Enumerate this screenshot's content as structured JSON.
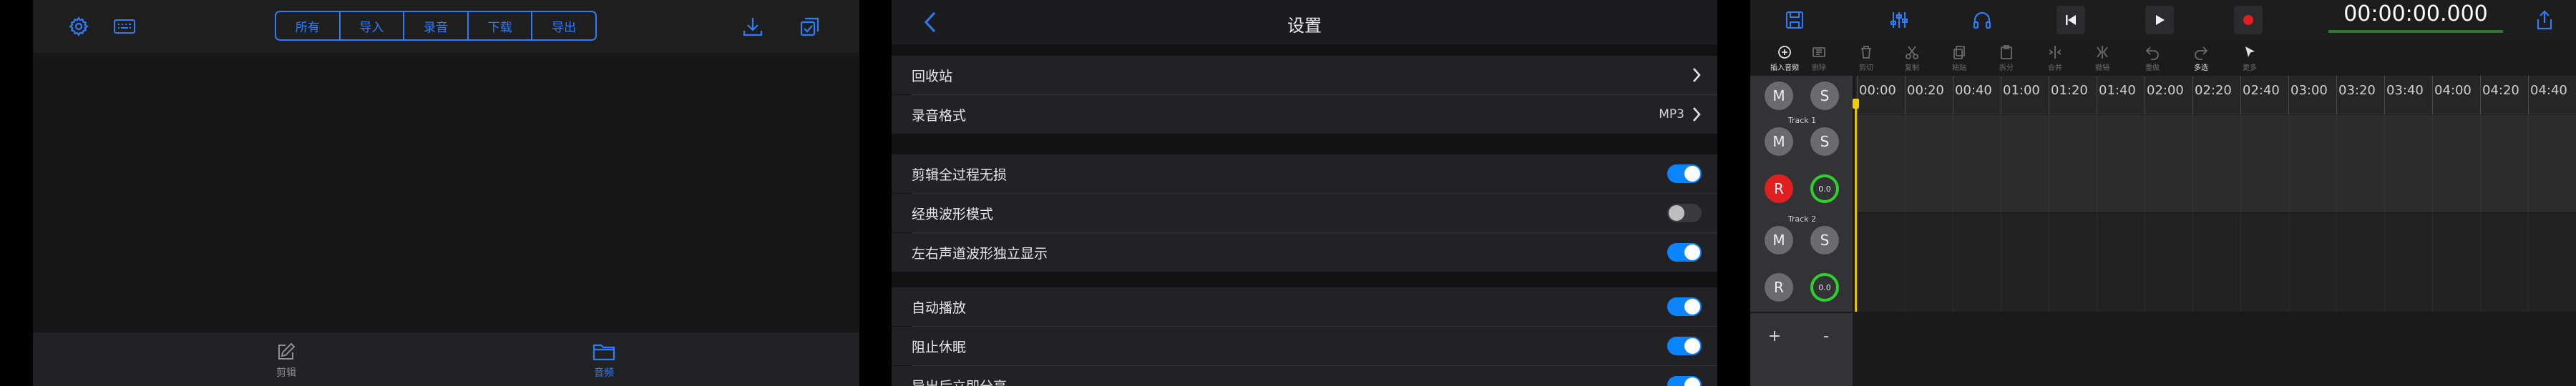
{
  "file_browser": {
    "segments": [
      {
        "label": "所有",
        "active": true
      },
      {
        "label": "导入",
        "active": false
      },
      {
        "label": "录音",
        "active": false
      },
      {
        "label": "下载",
        "active": false
      },
      {
        "label": "导出",
        "active": false
      }
    ],
    "icons": {
      "settings": "gear-icon",
      "keyboard": "keyboard-icon",
      "download": "download-icon",
      "select": "multi-select-icon"
    },
    "tabs": [
      {
        "label": "剪辑",
        "icon": "edit-icon",
        "active": false
      },
      {
        "label": "音频",
        "icon": "folder-icon",
        "active": true
      }
    ],
    "colors": {
      "accent": "#2f7df6",
      "inactive": "#8e8e93"
    }
  },
  "settings": {
    "title": "设置",
    "rows": [
      {
        "label": "回收站",
        "type": "chevron"
      },
      {
        "label": "录音格式",
        "type": "value",
        "value": "MP3"
      },
      {
        "label": "剪辑全过程无损",
        "type": "toggle",
        "on": true
      },
      {
        "label": "经典波形模式",
        "type": "toggle",
        "on": false
      },
      {
        "label": "左右声道波形独立显示",
        "type": "toggle",
        "on": true
      },
      {
        "label": "自动播放",
        "type": "toggle",
        "on": true
      },
      {
        "label": "阻止休眠",
        "type": "toggle",
        "on": true
      },
      {
        "label": "导出后立即分享",
        "type": "toggle",
        "on": true
      }
    ],
    "colors": {
      "toggle_on": "#0a84ff"
    }
  },
  "editor": {
    "time_display": "00:00:00.000",
    "top_icons": [
      "save-icon",
      "mixer-icon",
      "headphones-icon",
      "skip-back-icon",
      "play-icon",
      "record-icon",
      "share-icon"
    ],
    "edit_tools": [
      {
        "label": "插入音频",
        "icon": "insert-audio-icon",
        "enabled": true
      },
      {
        "label": "删除",
        "icon": "delete-icon",
        "enabled": false
      },
      {
        "label": "剪切",
        "icon": "cut-icon",
        "enabled": false
      },
      {
        "label": "复制",
        "icon": "copy-icon",
        "enabled": false
      },
      {
        "label": "粘贴",
        "icon": "paste-icon",
        "enabled": false
      },
      {
        "label": "拆分",
        "icon": "split-icon",
        "enabled": false
      },
      {
        "label": "合并",
        "icon": "merge-icon",
        "enabled": false
      },
      {
        "label": "撤销",
        "icon": "undo-icon",
        "enabled": false
      },
      {
        "label": "重做",
        "icon": "redo-icon",
        "enabled": false
      },
      {
        "label": "多选",
        "icon": "multiselect-icon",
        "enabled": true
      },
      {
        "label": "更多",
        "icon": "more-icon",
        "enabled": false
      }
    ],
    "ruler_ticks": [
      "00:00",
      "00:20",
      "00:40",
      "01:00",
      "01:20",
      "01:40",
      "02:00",
      "02:20",
      "02:40",
      "03:00",
      "03:20",
      "03:40",
      "04:00",
      "04:20",
      "04:40"
    ],
    "master": {
      "mute": "M",
      "solo": "S"
    },
    "tracks": [
      {
        "name": "Track 1",
        "mute": "M",
        "solo": "S",
        "record": "R",
        "record_armed": true,
        "volume": "0.0"
      },
      {
        "name": "Track 2",
        "mute": "M",
        "solo": "S",
        "record": "R",
        "record_armed": false,
        "volume": "0.0"
      }
    ],
    "add_track": "+",
    "remove_track": "-",
    "colors": {
      "playhead": "#e6c300",
      "record": "#e02020",
      "volume_ring": "#2ed02e"
    }
  }
}
